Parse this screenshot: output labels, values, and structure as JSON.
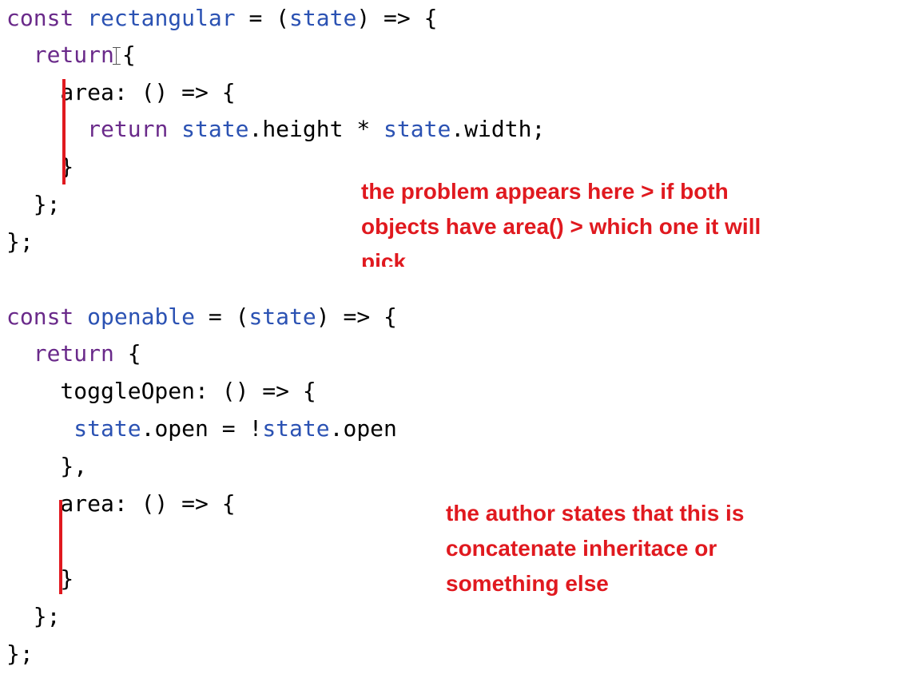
{
  "code_lines": [
    [
      {
        "t": "kw",
        "v": "const "
      },
      {
        "t": "id",
        "v": "rectangular"
      },
      {
        "t": "p",
        "v": " = ("
      },
      {
        "t": "id",
        "v": "state"
      },
      {
        "t": "p",
        "v": ") => {"
      }
    ],
    [
      {
        "t": "p",
        "v": "  "
      },
      {
        "t": "kw",
        "v": "return"
      },
      {
        "t": "cursor"
      },
      {
        "t": "p",
        "v": "{"
      }
    ],
    [
      {
        "t": "p",
        "v": "    area: () => {"
      }
    ],
    [
      {
        "t": "p",
        "v": "      "
      },
      {
        "t": "kw",
        "v": "return "
      },
      {
        "t": "id",
        "v": "state"
      },
      {
        "t": "p",
        "v": ".height * "
      },
      {
        "t": "id",
        "v": "state"
      },
      {
        "t": "p",
        "v": ".width;"
      }
    ],
    [
      {
        "t": "p",
        "v": "    }"
      }
    ],
    [
      {
        "t": "p",
        "v": "  };"
      }
    ],
    [
      {
        "t": "p",
        "v": "};"
      }
    ],
    [],
    [
      {
        "t": "kw",
        "v": "const "
      },
      {
        "t": "id",
        "v": "openable"
      },
      {
        "t": "p",
        "v": " = ("
      },
      {
        "t": "id",
        "v": "state"
      },
      {
        "t": "p",
        "v": ") => {"
      }
    ],
    [
      {
        "t": "p",
        "v": "  "
      },
      {
        "t": "kw",
        "v": "return"
      },
      {
        "t": "p",
        "v": " {"
      }
    ],
    [
      {
        "t": "p",
        "v": "    toggleOpen: () => {"
      }
    ],
    [
      {
        "t": "p",
        "v": "     "
      },
      {
        "t": "id",
        "v": "state"
      },
      {
        "t": "p",
        "v": ".open = !"
      },
      {
        "t": "id",
        "v": "state"
      },
      {
        "t": "p",
        "v": ".open"
      }
    ],
    [
      {
        "t": "p",
        "v": "    },"
      }
    ],
    [
      {
        "t": "p",
        "v": "    area: () => {"
      }
    ],
    [],
    [
      {
        "t": "p",
        "v": "    }"
      }
    ],
    [
      {
        "t": "p",
        "v": "  };"
      }
    ],
    [
      {
        "t": "p",
        "v": "};"
      }
    ]
  ],
  "annotations": {
    "top": [
      "the problem appears here > if both",
      "objects have area() > which one it will",
      "pick"
    ],
    "bottom": [
      "the author states that this is",
      "concatenate inheritace or",
      "something else"
    ]
  },
  "colors": {
    "keyword": "#6a2a8a",
    "identifier": "#2b52b3",
    "annotation": "#e0191f"
  }
}
